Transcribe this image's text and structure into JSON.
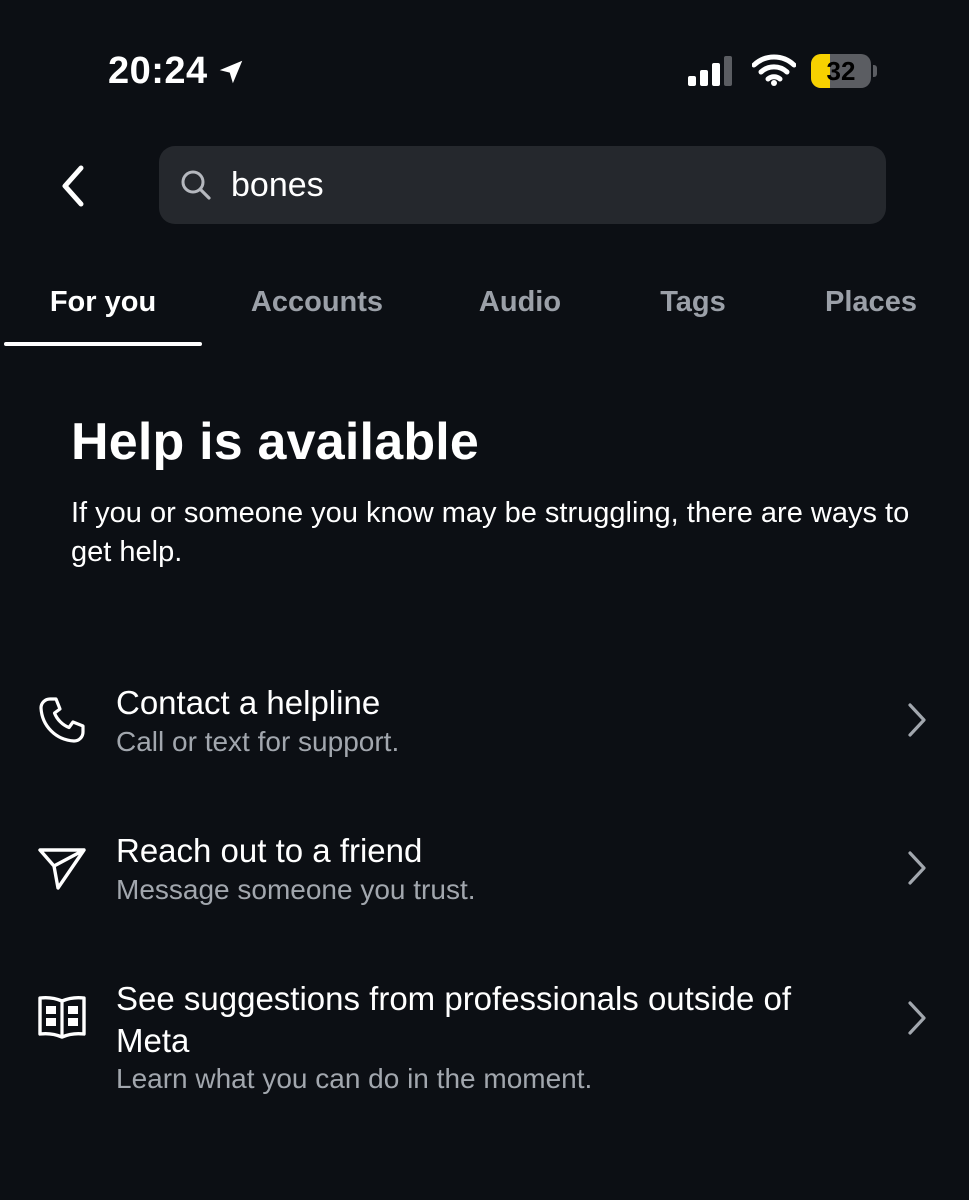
{
  "status_bar": {
    "time": "20:24",
    "battery_level": "32",
    "battery_fraction": 0.32,
    "icons": [
      "location-arrow-icon",
      "cellular-signal-icon",
      "wifi-icon",
      "battery-icon"
    ]
  },
  "header": {
    "back_icon": "chevron-left-icon",
    "search": {
      "icon": "search-icon",
      "value": "bones"
    }
  },
  "tabs": [
    {
      "label": "For you",
      "active": true
    },
    {
      "label": "Accounts",
      "active": false
    },
    {
      "label": "Audio",
      "active": false
    },
    {
      "label": "Tags",
      "active": false
    },
    {
      "label": "Places",
      "active": false
    }
  ],
  "help": {
    "title": "Help is available",
    "description": "If you or someone you know may be struggling, there are ways to get help."
  },
  "options": [
    {
      "icon": "phone-icon",
      "title": "Contact a helpline",
      "subtitle": "Call or text for support."
    },
    {
      "icon": "paper-plane-icon",
      "title": "Reach out to a friend",
      "subtitle": "Message someone you trust."
    },
    {
      "icon": "book-icon",
      "title": "See suggestions from professionals outside of Meta",
      "subtitle": "Learn what you can do in the moment."
    }
  ],
  "colors": {
    "background": "#0c0f14",
    "search_field": "#25282d",
    "inactive_tab": "#9ba0a8",
    "secondary_text": "#a2a7ae",
    "battery_fill": "#f7d100"
  }
}
